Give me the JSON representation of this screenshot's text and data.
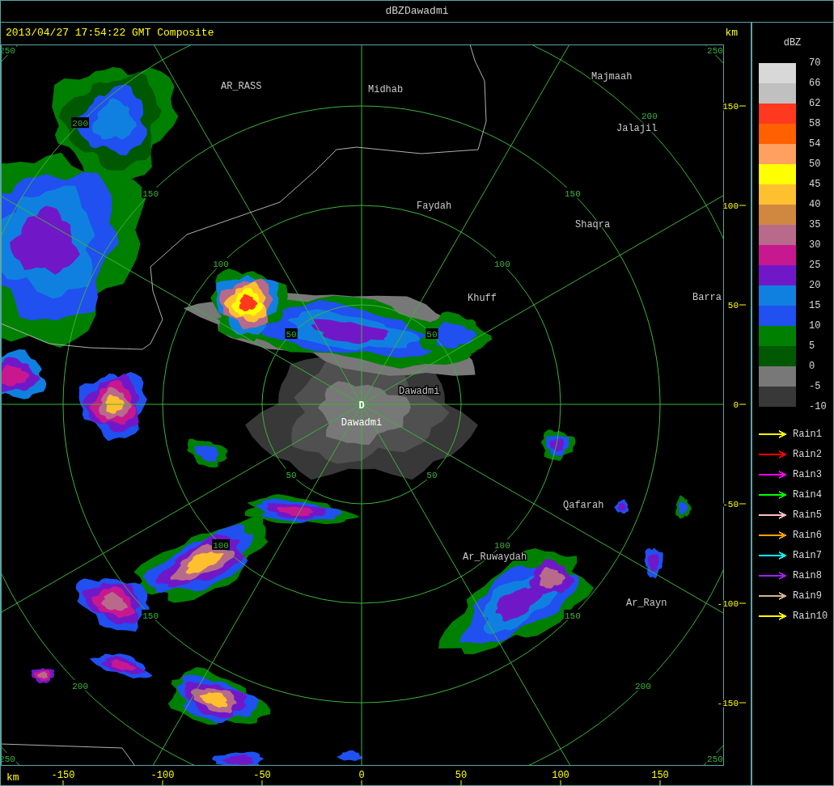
{
  "window": {
    "title": "dBZDawadmi"
  },
  "header": {
    "timestamp": "2013/04/27 17:54:22 GMT Composite",
    "unit": "km"
  },
  "map": {
    "range_labels": [
      "250",
      "250",
      "250",
      "250",
      "200",
      "150",
      "100",
      "50",
      "50",
      "100",
      "150",
      "200",
      "50",
      "100",
      "150",
      "200",
      "50",
      "100",
      "150",
      "200"
    ],
    "places": [
      "AR_RASS",
      "Midhab",
      "Majmaah",
      "Jalajil",
      "Faydah",
      "Shaqra",
      "Khuff",
      "Barra",
      "Dawadmi",
      "Qafarah",
      "Ar_Ruwaydah",
      "Ar_Rayn"
    ],
    "site": {
      "marker": "D",
      "name": "Dawadmi"
    }
  },
  "y_axis": {
    "ticks": [
      "150",
      "100",
      "50",
      "0",
      "-50",
      "-100",
      "-150"
    ]
  },
  "x_axis": {
    "unit": "km",
    "ticks": [
      "-150",
      "-100",
      "-50",
      "0",
      "50",
      "100",
      "150"
    ]
  },
  "legend": {
    "title": "dBZ",
    "bins": [
      {
        "color": "#d8d8d8"
      },
      {
        "color": "#c0c0c0"
      },
      {
        "color": "#ff3820"
      },
      {
        "color": "#ff6000"
      },
      {
        "color": "#ffa060"
      },
      {
        "color": "#ffff00"
      },
      {
        "color": "#ffc030"
      },
      {
        "color": "#d08840"
      },
      {
        "color": "#b86a8a"
      },
      {
        "color": "#c81890"
      },
      {
        "color": "#7018c8"
      },
      {
        "color": "#1080e0"
      },
      {
        "color": "#2050f0"
      },
      {
        "color": "#008000"
      },
      {
        "color": "#005800"
      },
      {
        "color": "#787878"
      },
      {
        "color": "#383838"
      }
    ],
    "scale_labels": [
      "70",
      "66",
      "62",
      "58",
      "54",
      "50",
      "45",
      "40",
      "35",
      "30",
      "25",
      "20",
      "15",
      "10",
      "5",
      "0",
      "-5",
      "-10"
    ],
    "tracks": [
      {
        "label": "Rain1",
        "color": "#ffff00"
      },
      {
        "label": "Rain2",
        "color": "#ff0000"
      },
      {
        "label": "Rain3",
        "color": "#ff00ff"
      },
      {
        "label": "Rain4",
        "color": "#00ff00"
      },
      {
        "label": "Rain5",
        "color": "#ffc0c0"
      },
      {
        "label": "Rain6",
        "color": "#ffa000"
      },
      {
        "label": "Rain7",
        "color": "#00ffff"
      },
      {
        "label": "Rain8",
        "color": "#a020f0"
      },
      {
        "label": "Rain9",
        "color": "#d2b48c"
      },
      {
        "label": "Rain10",
        "color": "#ffff00"
      }
    ]
  }
}
